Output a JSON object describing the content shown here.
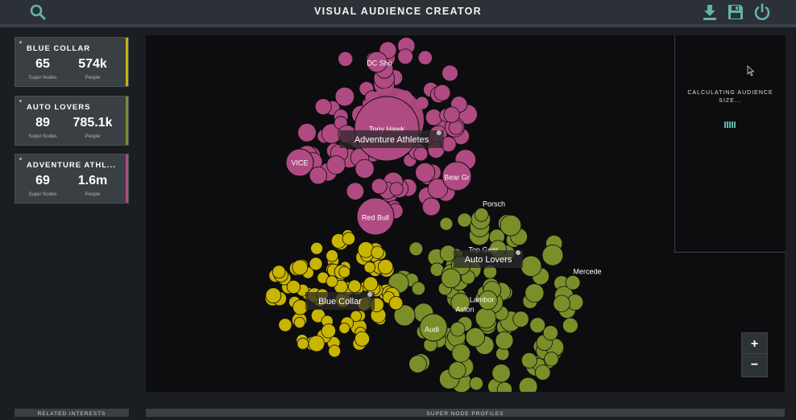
{
  "app": {
    "title": "VISUAL AUDIENCE CREATOR"
  },
  "colors": {
    "accent": "#5fb5aa",
    "blue_collar": "#c9b400",
    "auto_lovers": "#7a8f2a",
    "adventure_athletes": "#b04a82"
  },
  "audiences": [
    {
      "name": "BLUE COLLAR",
      "super_nodes": "65",
      "super_nodes_label": "Super Nodes",
      "people": "574k",
      "people_label": "People"
    },
    {
      "name": "AUTO LOVERS",
      "super_nodes": "89",
      "super_nodes_label": "Super Nodes",
      "people": "785.1k",
      "people_label": "People"
    },
    {
      "name": "ADVENTURE ATHL...",
      "super_nodes": "69",
      "super_nodes_label": "Super Nodes",
      "people": "1.6m",
      "people_label": "People"
    }
  ],
  "clusters": [
    {
      "key": "adventure_athletes",
      "label": "Adventure Athletes",
      "color": "#b04a82",
      "nodes": [
        "DC Sho",
        "Tony Hawk",
        "VICE",
        "Bear Gr",
        "Red Bull"
      ]
    },
    {
      "key": "auto_lovers",
      "label": "Auto Lovers",
      "color": "#7a8f2a",
      "nodes": [
        "Porsch",
        "Top Gear",
        "Mercede",
        "Lambor",
        "Aston",
        "Audi"
      ]
    },
    {
      "key": "blue_collar",
      "label": "Blue Collar",
      "color": "#c9b400",
      "nodes": []
    }
  ],
  "calc": {
    "line1": "CALCULATING AUDIENCE",
    "line2": "SIZE..."
  },
  "zoom": {
    "in": "+",
    "out": "−"
  },
  "bottom": {
    "related": "RELATED INTERESTS",
    "profiles": "SUPER NODE PROFILES"
  },
  "icons": [
    "search-icon",
    "download-icon",
    "save-icon",
    "power-icon"
  ]
}
